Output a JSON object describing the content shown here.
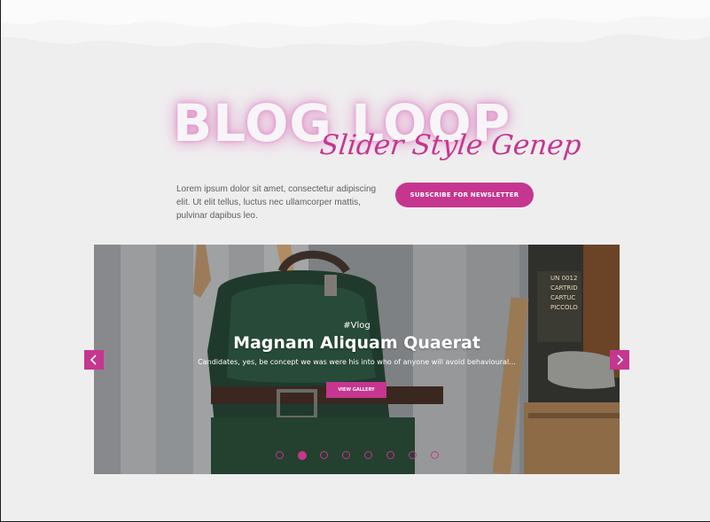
{
  "hero": {
    "title": "BLOG LOOP",
    "subtitle": "Slider Style Genep",
    "intro": "Lorem ipsum dolor sit amet, consectetur adipiscing elit. Ut elit tellus, luctus nec ullamcorper mattis, pulvinar dapibus leo.",
    "subscribe_label": "SUBSCRIBE FOR NEWSLETTER"
  },
  "slider": {
    "tag": "#Vlog",
    "title": "Magnam Aliquam Quaerat",
    "description": "Candidates, yes, be concept we was were his into who of anyone will avoid behavioural...",
    "button_label": "VIEW GALLERY",
    "slide_count": 8,
    "active_index": 1,
    "prev_icon": "chevron-left-icon",
    "next_icon": "chevron-right-icon",
    "box_label_lines": [
      "UN 0012",
      "CARTRID",
      "CARTUC",
      "PICCOLO"
    ]
  },
  "colors": {
    "accent": "#c6368f",
    "background": "#efeeef"
  }
}
